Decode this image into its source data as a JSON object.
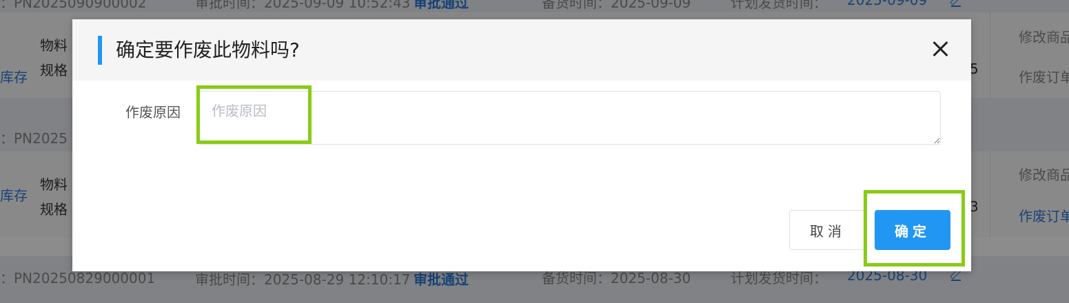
{
  "background": {
    "row1": {
      "order": "：PN2025090900002",
      "approve_label": "审批时间：2025-09-09 10:52:43",
      "approve_status": "审批通过",
      "stock_label": "备货时间：2025-09-09",
      "plan_label": "计划发货时间：",
      "plan_value": "2025-09-09"
    },
    "item1": {
      "stock": "库存",
      "line1": "物料",
      "line2": "规格",
      "num": "5",
      "action1": "修改商品",
      "action2": "作废订单"
    },
    "row2": {
      "order": "：PN2025"
    },
    "item2": {
      "stock": "库存",
      "line1": "物料",
      "line2": "规格",
      "num": "3",
      "action1": "修改商品",
      "action2": "作废订单"
    },
    "row3": {
      "order": "：PN20250829000001",
      "approve_label": "审批时间：2025-08-29 12:10:17",
      "approve_status": "审批通过",
      "stock_label": "备货时间：2025-08-30",
      "plan_label": "计划发货时间：",
      "plan_value": "2025-08-30"
    }
  },
  "dialog": {
    "title": "确定要作废此物料吗?",
    "reason_label": "作废原因",
    "reason_placeholder": "作废原因",
    "reason_value": "",
    "cancel_label": "取消",
    "confirm_label": "确定",
    "accent_color": "#2196f3",
    "highlight_color": "#88cc14",
    "close_icon": "close-icon"
  }
}
